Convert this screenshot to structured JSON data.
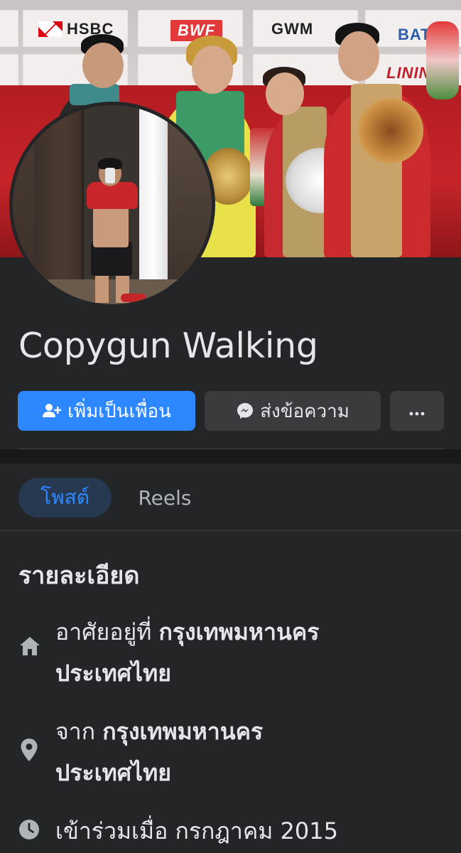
{
  "cover": {
    "banner_logos": [
      "HSBC",
      "BWF",
      "GWM",
      "BAT",
      "LINING"
    ]
  },
  "profile": {
    "name": "Copygun Walking"
  },
  "actions": {
    "add_friend_label": "เพิ่มเป็นเพื่อน",
    "message_label": "ส่งข้อความ",
    "more_label": "···"
  },
  "tabs": [
    {
      "label": "โพสต์",
      "active": true
    },
    {
      "label": "Reels",
      "active": false
    }
  ],
  "details": {
    "title": "รายละเอียด",
    "lives_in": {
      "prefix": "อาศัยอยู่ที่",
      "place": "กรุงเทพมหานคร",
      "country": "ประเทศไทย"
    },
    "from": {
      "prefix": "จาก",
      "place": "กรุงเทพมหานคร",
      "country": "ประเทศไทย"
    },
    "joined": {
      "text": "เข้าร่วมเมื่อ กรกฎาคม  2015"
    }
  },
  "colors": {
    "background": "#242526",
    "primary": "#2d88ff",
    "secondary_button": "#3a3b3c",
    "active_tab_bg": "#263951",
    "text": "#e4e6eb",
    "muted_text": "#b0b3b8",
    "icon": "#b0b3b8"
  },
  "icons": {
    "add_friend": "person-plus-icon",
    "message": "messenger-icon",
    "more": "more-dots-icon",
    "lives_in": "home-icon",
    "from": "location-pin-icon",
    "joined": "clock-icon"
  }
}
